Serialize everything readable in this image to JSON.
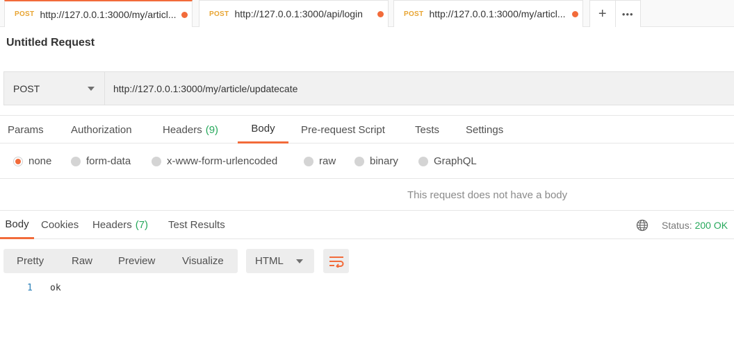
{
  "tabs": [
    {
      "method": "POST",
      "url": "http://127.0.0.1:3000/my/articl...",
      "unsaved": true,
      "active": true
    },
    {
      "method": "POST",
      "url": "http://127.0.0.1:3000/api/login",
      "unsaved": true,
      "active": false
    },
    {
      "method": "POST",
      "url": "http://127.0.0.1:3000/my/articl...",
      "unsaved": true,
      "active": false
    }
  ],
  "tab_actions": {
    "new_tab": "+",
    "more": "•••"
  },
  "request": {
    "title": "Untitled Request",
    "method": "POST",
    "url": "http://127.0.0.1:3000/my/article/updatecate"
  },
  "request_tabs": {
    "params": "Params",
    "authorization": "Authorization",
    "headers": "Headers",
    "headers_count": "(9)",
    "body": "Body",
    "pre_request": "Pre-request Script",
    "tests": "Tests",
    "settings": "Settings"
  },
  "body_types": {
    "none": "none",
    "form_data": "form-data",
    "urlencoded": "x-www-form-urlencoded",
    "raw": "raw",
    "binary": "binary",
    "graphql": "GraphQL",
    "selected": "none"
  },
  "no_body_message": "This request does not have a body",
  "response_tabs": {
    "body": "Body",
    "cookies": "Cookies",
    "headers": "Headers",
    "headers_count": "(7)",
    "test_results": "Test Results"
  },
  "status": {
    "label": "Status:",
    "value": "200 OK"
  },
  "view_modes": {
    "pretty": "Pretty",
    "raw": "Raw",
    "preview": "Preview",
    "visualize": "Visualize"
  },
  "format": "HTML",
  "response_lines": [
    {
      "number": "1",
      "text": "ok"
    }
  ],
  "colors": {
    "accent": "#f26b3a",
    "method_post": "#e8a431",
    "success": "#26a85b"
  }
}
